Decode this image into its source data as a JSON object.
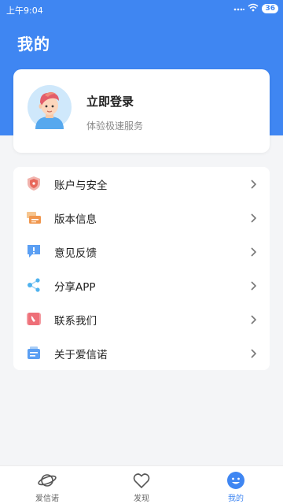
{
  "status_bar": {
    "time": "上午9:04",
    "battery": "36"
  },
  "header": {
    "title": "我的"
  },
  "profile": {
    "title": "立即登录",
    "subtitle": "体验极速服务"
  },
  "menu": {
    "items": [
      {
        "label": "账户与安全",
        "icon": "shield-icon"
      },
      {
        "label": "版本信息",
        "icon": "version-info-icon"
      },
      {
        "label": "意见反馈",
        "icon": "feedback-icon"
      },
      {
        "label": "分享APP",
        "icon": "share-icon"
      },
      {
        "label": "联系我们",
        "icon": "phone-icon"
      },
      {
        "label": "关于爱信诺",
        "icon": "about-icon"
      }
    ]
  },
  "tabs": [
    {
      "label": "爱信诺",
      "icon": "planet-icon"
    },
    {
      "label": "发现",
      "icon": "heart-icon"
    },
    {
      "label": "我的",
      "icon": "smile-face-icon",
      "active": true
    }
  ],
  "colors": {
    "primary": "#3f86f2",
    "background": "#f4f5f7"
  }
}
